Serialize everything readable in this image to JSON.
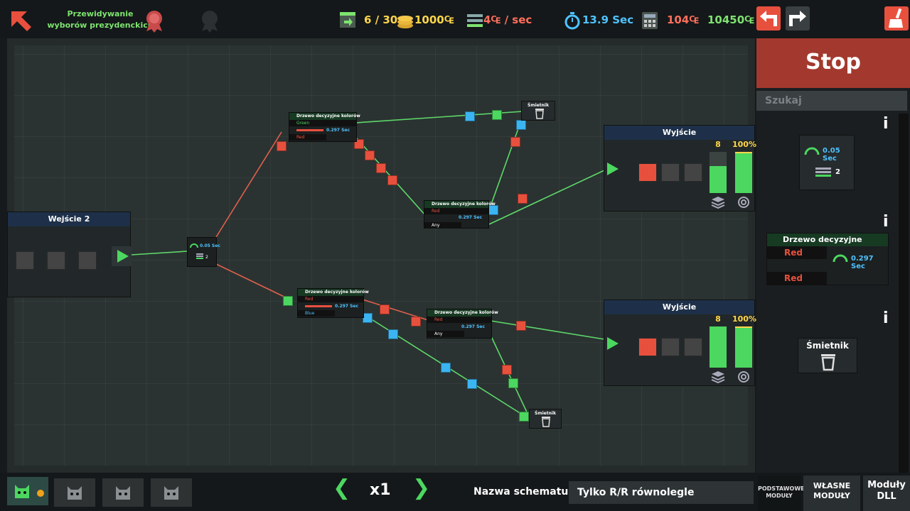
{
  "header": {
    "level_title_line1": "Przewidywanie",
    "level_title_line2": "wyborów prezydenckich",
    "modules": "6 / 30",
    "coins": "1000₠",
    "cost_rate": "4₠ / sec",
    "time": "13.9 Sec",
    "cost": "104₠",
    "total": "10450₠"
  },
  "colors": {
    "accent_red": "#e8503e",
    "accent_green": "#4cd760",
    "accent_blue": "#3bb4f2",
    "stop_button": "#a3392e",
    "node_header_blue": "#1e3049",
    "node_header_green": "#173a23"
  },
  "canvas": {
    "input_node": {
      "title": "Wejście 2"
    },
    "splitter": {
      "speed": "0.05 Sec",
      "count": "2"
    },
    "tree_top_left": {
      "title": "Drzewo decyzyjne kolorów",
      "out1": "Green",
      "out2": "Red",
      "speed": "0.297 Sec"
    },
    "tree_top_right": {
      "title": "Drzewo decyzyjne kolorów",
      "out1": "Red",
      "out2": "Any",
      "speed": "0.297 Sec"
    },
    "tree_bottom_left": {
      "title": "Drzewo decyzyjne kolorów",
      "out1": "Red",
      "out2": "Blue",
      "speed": "0.297 Sec"
    },
    "tree_bottom_right": {
      "title": "Drzewo decyzyjne kolorów",
      "out1": "Red",
      "out2": "Any",
      "speed": "0.297 Sec"
    },
    "trash_top": {
      "title": "Śmietnik"
    },
    "trash_bottom": {
      "title": "Śmietnik"
    },
    "output_top": {
      "title": "Wyjście",
      "count": "8",
      "percent": "100%",
      "fill_fraction": 0.65,
      "percent_fraction": 1.0
    },
    "output_bottom": {
      "title": "Wyjście",
      "count": "8",
      "percent": "100%",
      "fill_fraction": 1.0,
      "percent_fraction": 1.0
    }
  },
  "side_panel": {
    "stop_label": "Stop",
    "search_placeholder": "Szukaj",
    "palette": [
      {
        "speed": "0.05 Sec",
        "count": "2"
      },
      {
        "title": "Drzewo decyzyjne kolorów",
        "out1": "Red",
        "out2": "Red",
        "speed": "0.297 Sec"
      },
      {
        "title": "Śmietnik"
      }
    ],
    "tabs": [
      {
        "label": "PODSTAWOWE MODUŁY"
      },
      {
        "label": "WŁASNE MODUŁY"
      },
      {
        "label": "Moduły DLL"
      }
    ]
  },
  "footer": {
    "speed": "x1",
    "schema_label": "Nazwa schematu:",
    "schema_name": "Tylko R/R równolegle"
  }
}
